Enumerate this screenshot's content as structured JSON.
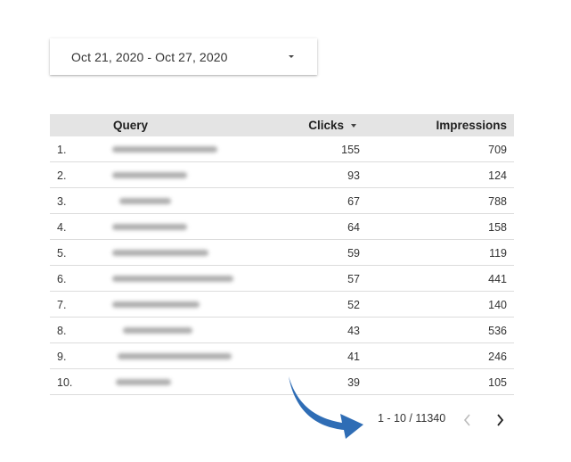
{
  "date_range": {
    "label": "Oct 21, 2020 - Oct 27, 2020",
    "icon": "dropdown-caret-icon"
  },
  "table": {
    "columns": [
      "Query",
      "Clicks",
      "Impressions"
    ],
    "sort_icon": "sort-descending-icon",
    "rows": [
      {
        "num": "1.",
        "clicks": "155",
        "impressions": "709"
      },
      {
        "num": "2.",
        "clicks": "93",
        "impressions": "124"
      },
      {
        "num": "3.",
        "clicks": "67",
        "impressions": "788"
      },
      {
        "num": "4.",
        "clicks": "64",
        "impressions": "158"
      },
      {
        "num": "5.",
        "clicks": "59",
        "impressions": "119"
      },
      {
        "num": "6.",
        "clicks": "57",
        "impressions": "441"
      },
      {
        "num": "7.",
        "clicks": "52",
        "impressions": "140"
      },
      {
        "num": "8.",
        "clicks": "43",
        "impressions": "536"
      },
      {
        "num": "9.",
        "clicks": "41",
        "impressions": "246"
      },
      {
        "num": "10.",
        "clicks": "39",
        "impressions": "105"
      }
    ]
  },
  "pagination": {
    "text": "1 - 10 / 11340",
    "prev_icon": "chevron-left-icon",
    "next_icon": "chevron-right-icon"
  },
  "annotation": {
    "icon": "curved-arrow-icon",
    "color": "#2f6db5"
  }
}
